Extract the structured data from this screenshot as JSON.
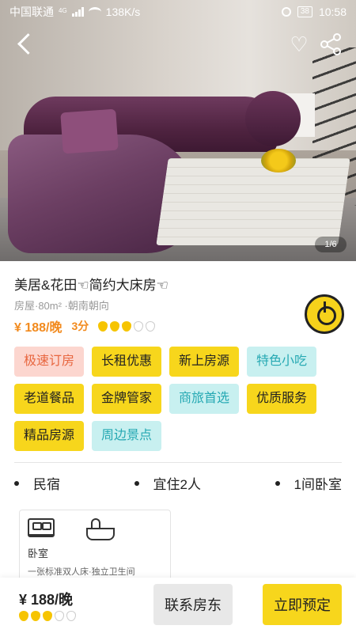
{
  "status_bar": {
    "carrier": "中国联通",
    "network": "4G",
    "speed": "138K/s",
    "battery": "38",
    "time": "10:58"
  },
  "gallery": {
    "photo_counter": "1/6",
    "icons": [
      "back-icon",
      "heart-icon",
      "share-icon"
    ]
  },
  "listing": {
    "title": "美居&花田☜简约大床房☜",
    "meta": "房屋·80m² ·朝南朝向",
    "price": "¥ 188/晚",
    "score": "3分",
    "rating_filled": 3,
    "rating_total": 5
  },
  "tags": [
    {
      "label": "极速订房",
      "style": "pink"
    },
    {
      "label": "长租优惠",
      "style": "yellow"
    },
    {
      "label": "新上房源",
      "style": "yellow"
    },
    {
      "label": "特色小吃",
      "style": "cyan"
    },
    {
      "label": "老道餐品",
      "style": "yellow"
    },
    {
      "label": "金牌管家",
      "style": "yellow"
    },
    {
      "label": "商旅首选",
      "style": "cyan"
    },
    {
      "label": "优质服务",
      "style": "yellow"
    },
    {
      "label": "精品房源",
      "style": "yellow"
    },
    {
      "label": "周边景点",
      "style": "cyan"
    }
  ],
  "features": [
    "民宿",
    "宜住2人",
    "1间卧室"
  ],
  "room": {
    "label": "卧室",
    "description": "一张标准双人床·独立卫生间"
  },
  "bottom_bar": {
    "price": "¥ 188/晚",
    "contact_label": "联系房东",
    "book_label": "立即预定"
  },
  "colors": {
    "accent_yellow": "#f7d61c",
    "price_orange": "#f28a1d",
    "tag_pink_bg": "#fcd6cf",
    "tag_cyan_bg": "#c8f0f0"
  }
}
